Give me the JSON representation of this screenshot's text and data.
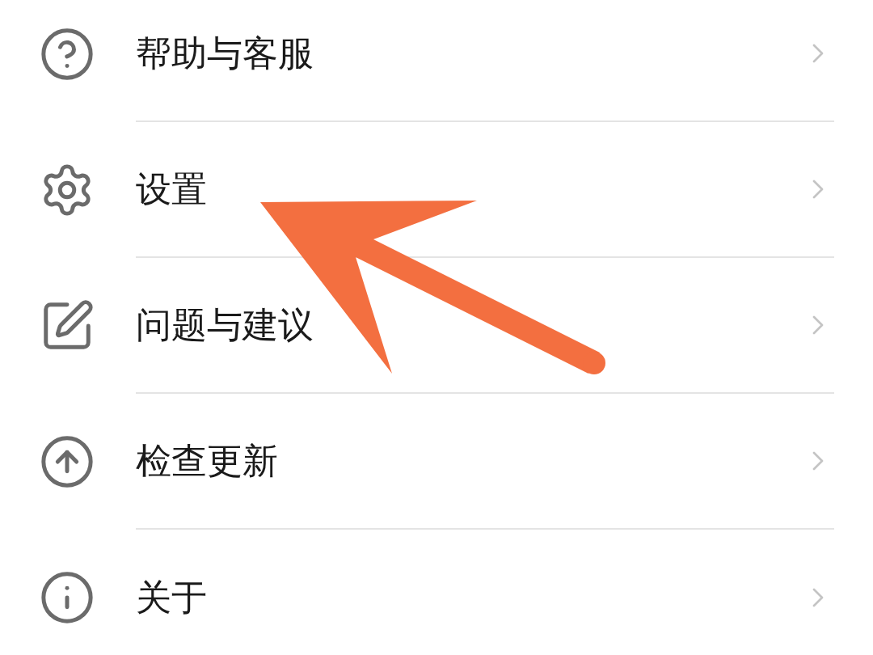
{
  "menu": {
    "items": [
      {
        "label": "帮助与客服"
      },
      {
        "label": "设置"
      },
      {
        "label": "问题与建议"
      },
      {
        "label": "检查更新"
      },
      {
        "label": "关于"
      }
    ]
  }
}
